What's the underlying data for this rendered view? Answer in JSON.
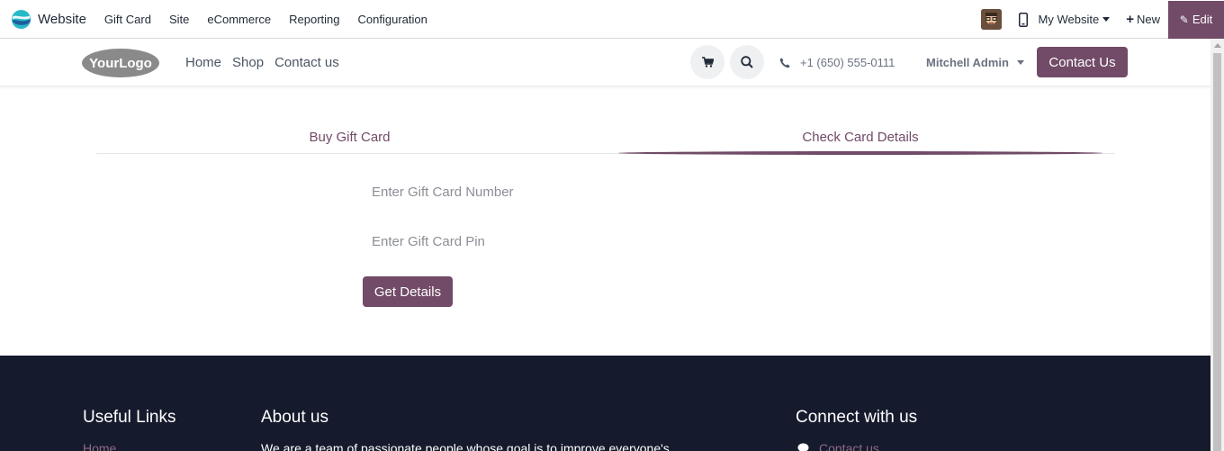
{
  "admin_bar": {
    "app_name": "Website",
    "menu": [
      "Gift Card",
      "Site",
      "eCommerce",
      "Reporting",
      "Configuration"
    ],
    "website_switch": "My Website",
    "new_label": "New",
    "edit_label": "Edit",
    "accent": "#714b67"
  },
  "header": {
    "logo_text": "YourLogo",
    "nav": [
      "Home",
      "Shop",
      "Contact us"
    ],
    "phone": "+1 (650) 555-0111",
    "user": "Mitchell Admin",
    "contact_button": "Contact Us"
  },
  "tabs": {
    "buy": "Buy Gift Card",
    "check": "Check Card Details",
    "active": "check"
  },
  "form": {
    "card_number_placeholder": "Enter Gift Card Number",
    "card_pin_placeholder": "Enter Gift Card Pin",
    "submit_label": "Get Details"
  },
  "footer": {
    "useful_links_title": "Useful Links",
    "home_link": "Home",
    "about_title": "About us",
    "about_text": "We are a team of passionate people whose goal is to improve everyone's",
    "connect_title": "Connect with us",
    "contact_link": "Contact us"
  }
}
